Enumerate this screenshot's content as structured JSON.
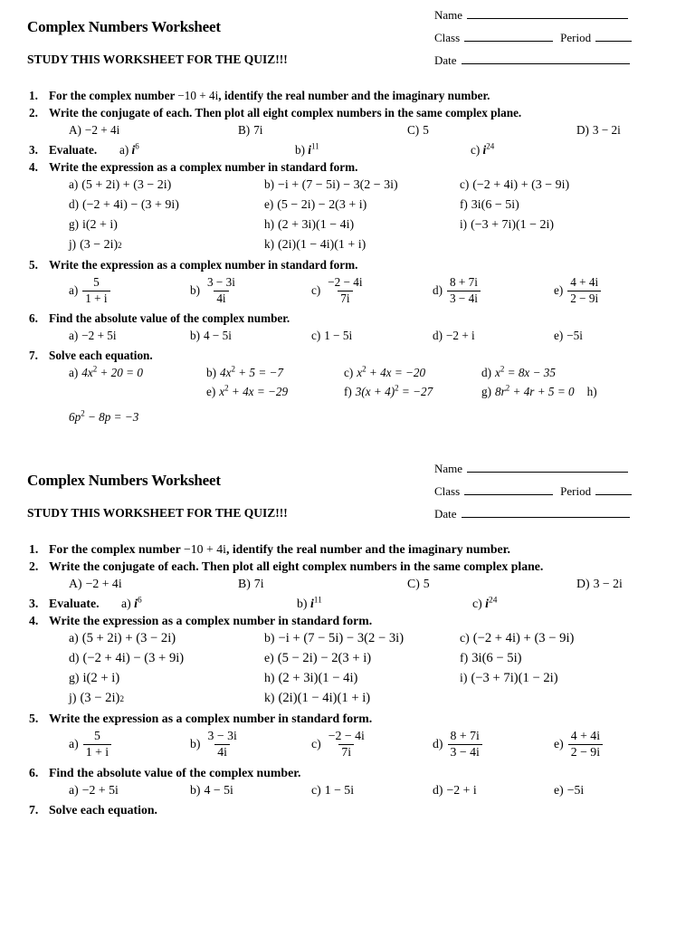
{
  "header": {
    "title": "Complex Numbers Worksheet",
    "subtitle": "STUDY THIS WORKSHEET FOR THE QUIZ!!!",
    "name_label": "Name",
    "class_label": "Class",
    "period_label": "Period",
    "date_label": "Date",
    "name_value": "",
    "class_value": "",
    "period_value": "",
    "date_value": ""
  },
  "problems": {
    "p1": {
      "num": "1.",
      "text_before": "For the complex number",
      "expr": "−10 + 4i",
      "text_after": ", identify the real number and the imaginary number."
    },
    "p2": {
      "num": "2.",
      "prompt": "Write the conjugate of each. Then plot all eight complex numbers in the same complex plane.",
      "parts": [
        {
          "tag": "A)",
          "expr": "−2 + 4i"
        },
        {
          "tag": "B)",
          "expr": "7i"
        },
        {
          "tag": "C)",
          "expr": "5"
        },
        {
          "tag": "D)",
          "expr": "3 − 2i"
        }
      ]
    },
    "p3": {
      "num": "3.",
      "prompt": "Evaluate.",
      "parts": [
        {
          "tag": "a)",
          "base": "i",
          "exp": "6"
        },
        {
          "tag": "b)",
          "base": "i",
          "exp": "11"
        },
        {
          "tag": "c)",
          "base": "i",
          "exp": "24"
        }
      ]
    },
    "p4": {
      "num": "4.",
      "prompt": "Write the expression as a complex number in standard form.",
      "parts": [
        {
          "tag": "a)",
          "expr": "(5 + 2i) + (3 − 2i)"
        },
        {
          "tag": "b)",
          "expr": "−i + (7 − 5i) − 3(2 − 3i)"
        },
        {
          "tag": "c)",
          "expr": "(−2 + 4i) + (3 − 9i)"
        },
        {
          "tag": "d)",
          "expr": "(−2 + 4i) − (3 + 9i)"
        },
        {
          "tag": "e)",
          "expr": "(5 − 2i) − 2(3 + i)"
        },
        {
          "tag": "f)",
          "expr": "3i(6 − 5i)"
        },
        {
          "tag": "g)",
          "expr": "i(2 + i)"
        },
        {
          "tag": "h)",
          "expr": "(2 + 3i)(1 − 4i)"
        },
        {
          "tag": "i)",
          "expr": "(−3 + 7i)(1 − 2i)"
        },
        {
          "tag": "j)",
          "expr": "(3 − 2i)",
          "exp": "2"
        },
        {
          "tag": "k)",
          "expr": "(2i)(1 − 4i)(1 + i)"
        }
      ]
    },
    "p5": {
      "num": "5.",
      "prompt": "Write the expression as a complex number in standard form.",
      "parts": [
        {
          "tag": "a)",
          "num": "5",
          "den": "1 + i"
        },
        {
          "tag": "b)",
          "num": "3 − 3i",
          "den": "4i"
        },
        {
          "tag": "c)",
          "num": "−2 − 4i",
          "den": "7i"
        },
        {
          "tag": "d)",
          "num": "8 + 7i",
          "den": "3 − 4i"
        },
        {
          "tag": "e)",
          "num": "4 + 4i",
          "den": "2 − 9i"
        }
      ]
    },
    "p6": {
      "num": "6.",
      "prompt": "Find the absolute value of the complex number.",
      "parts": [
        {
          "tag": "a)",
          "expr": "−2 + 5i"
        },
        {
          "tag": "b)",
          "expr": "4 − 5i"
        },
        {
          "tag": "c)",
          "expr": "1 − 5i"
        },
        {
          "tag": "d)",
          "expr": "−2 + i"
        },
        {
          "tag": "e)",
          "expr": "−5i"
        }
      ]
    },
    "p7": {
      "num": "7.",
      "prompt": "Solve each equation.",
      "row1": [
        {
          "tag": "a)",
          "lhs": "4x",
          "exp": "2",
          "rest": " + 20 = 0"
        },
        {
          "tag": "b)",
          "lhs": "4x",
          "exp": "2",
          "rest": " + 5 = −7"
        },
        {
          "tag": "c)",
          "lhs": "x",
          "exp": "2",
          "rest": " + 4x = −20"
        },
        {
          "tag": "d)",
          "lhs": "x",
          "exp": "2",
          "rest": " = 8x − 35"
        }
      ],
      "row2": [
        {
          "tag": "e)",
          "lhs": "x",
          "exp": "2",
          "rest": " + 4x = −29"
        },
        {
          "tag": "f)",
          "lhs": "3(x + 4)",
          "exp": "2",
          "rest": " = −27"
        },
        {
          "tag": "g)",
          "lhs": "8r",
          "exp": "2",
          "rest": " + 4r + 5 = 0"
        },
        {
          "tag": "h)",
          "lhs": "",
          "exp": "",
          "rest": ""
        }
      ],
      "row3": {
        "lhs": "6p",
        "exp": "2",
        "rest": " − 8p = −3"
      }
    }
  }
}
